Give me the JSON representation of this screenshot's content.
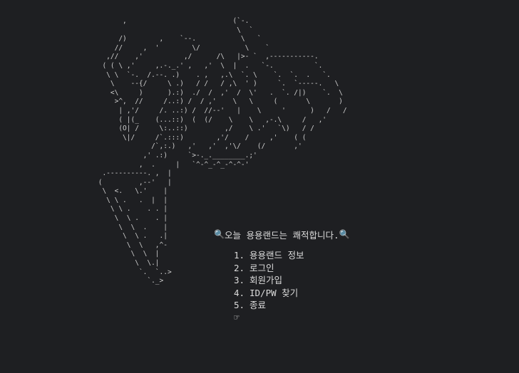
{
  "ascii_art": "       ,                          (`-.\n                                   \\  `\n      /)        ,    `--.           \\   `\n     //     ,  '        \\/           \\    `\n   ,//    ,'          ,/      /\\   |>- `  ,-----------.\n  ( ( \\ ,'     ,.-._.' ,   ,'  \\  |  .   `-.          `.\n   \\ \\  `-.  /.--. .)    . ,   ,.\\  `. \\    `.  `.  .   `.\n    \\    --{/     \\ .)   / /   / ,\\  ' )     `.  `-----.   \\\n    <\\     )      ).:)  ./  /  ,'  /  \\'   .  `. /|)    `.  \\\n     >^,  //     /..:) /  / ,'    \\   \\     (       \\       )\n      | ,'/     /. ..:) /  //--'   |    \\     '      )   /   /\n      ( |(_    (...::)  (  (/    \\    \\   ,-.\\     /   ,'\n      (O| /     \\:..::)         ,/    \\ .'   `\\)   / /\n       \\|/     /`.:::)        ,'/    /     ,'    ( (\n              /`,:.)   ,'   ,'  ,'\\/    (/       ,'\n            ,' .:)     `>-._.________.;'\n           ,  .     |   `^-^_-^_-^-^-'\n  .----------. ,  |\n (         ,--'   |\n  \\  <.   \\.'    |\n   \\ \\ .   .  |  |\n    \\ \\ .    . . |\n     \\  \\ .    . |\n      \\  \\  .    |\n       \\  \\ .   .|\n        \\  \\   ,^-\n         \\  \\  |\n          \\  \\.|\n           `.  `..>\n             `._>",
  "menu": {
    "greeting": "오늘 용용랜드는 쾌적합니다.",
    "greeting_icon_left": "🔍",
    "greeting_icon_right": "🔍",
    "items": [
      {
        "num": "1.",
        "label": "용용랜드 정보"
      },
      {
        "num": "2.",
        "label": "로그인"
      },
      {
        "num": "3.",
        "label": "회원가입"
      },
      {
        "num": "4.",
        "label": "ID/PW 찾기"
      },
      {
        "num": "5.",
        "label": "종료"
      }
    ],
    "prompt_icon": "☞"
  },
  "colors": {
    "background": "#1e1f22",
    "text": "#dcdcdc",
    "art": "#cfcfcf"
  }
}
